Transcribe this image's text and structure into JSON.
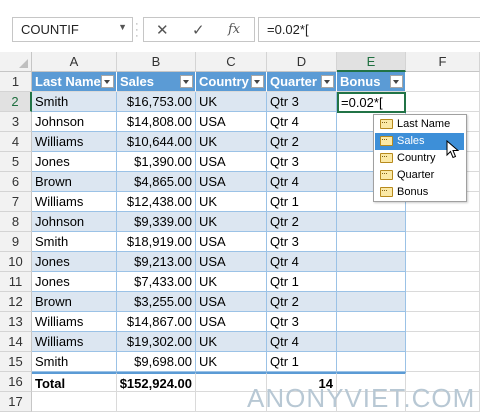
{
  "formula_bar": {
    "name_box": "COUNTIF",
    "cancel_icon": "✕",
    "enter_icon": "✓",
    "fx_icon": "fx",
    "formula": "=0.02*["
  },
  "columns": [
    "A",
    "B",
    "C",
    "D",
    "E",
    "F"
  ],
  "row_numbers": [
    "1",
    "2",
    "3",
    "4",
    "5",
    "6",
    "7",
    "8",
    "9",
    "10",
    "11",
    "12",
    "13",
    "14",
    "15",
    "16",
    "17"
  ],
  "table": {
    "headers": [
      "Last Name",
      "Sales",
      "Country",
      "Quarter",
      "Bonus"
    ],
    "rows": [
      [
        "Smith",
        "$16,753.00",
        "UK",
        "Qtr 3"
      ],
      [
        "Johnson",
        "$14,808.00",
        "USA",
        "Qtr 4"
      ],
      [
        "Williams",
        "$10,644.00",
        "UK",
        "Qtr 2"
      ],
      [
        "Jones",
        "$1,390.00",
        "USA",
        "Qtr 3"
      ],
      [
        "Brown",
        "$4,865.00",
        "USA",
        "Qtr 4"
      ],
      [
        "Williams",
        "$12,438.00",
        "UK",
        "Qtr 1"
      ],
      [
        "Johnson",
        "$9,339.00",
        "UK",
        "Qtr 2"
      ],
      [
        "Smith",
        "$18,919.00",
        "USA",
        "Qtr 3"
      ],
      [
        "Jones",
        "$9,213.00",
        "USA",
        "Qtr 4"
      ],
      [
        "Jones",
        "$7,433.00",
        "UK",
        "Qtr 1"
      ],
      [
        "Brown",
        "$3,255.00",
        "USA",
        "Qtr 2"
      ],
      [
        "Williams",
        "$14,867.00",
        "USA",
        "Qtr 3"
      ],
      [
        "Williams",
        "$19,302.00",
        "UK",
        "Qtr 4"
      ],
      [
        "Smith",
        "$9,698.00",
        "UK",
        "Qtr 1"
      ]
    ],
    "total": {
      "label": "Total",
      "sales": "$152,924.00",
      "quarter_count": "14"
    },
    "active_cell_value": "=0.02*["
  },
  "autocomplete": {
    "items": [
      "Last Name",
      "Sales",
      "Country",
      "Quarter",
      "Bonus"
    ],
    "highlighted": "Sales"
  },
  "watermark": "ANONYVIET.COM",
  "colors": {
    "header": "#5b9bd5",
    "band": "#dce6f1",
    "selection": "#217346",
    "highlight": "#3d8fd8"
  }
}
